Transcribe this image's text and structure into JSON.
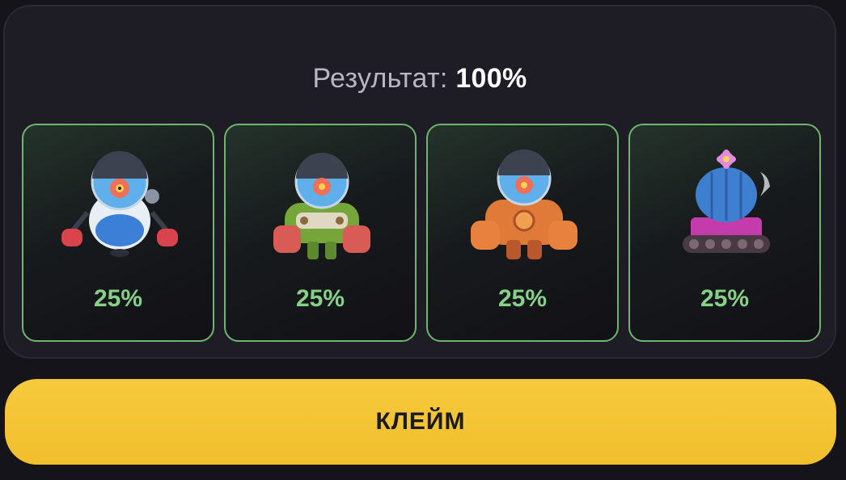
{
  "result": {
    "label": "Результат:",
    "value": "100%"
  },
  "items": [
    {
      "name": "blue-robot",
      "percent": "25%"
    },
    {
      "name": "green-robot",
      "percent": "25%"
    },
    {
      "name": "orange-robot",
      "percent": "25%"
    },
    {
      "name": "cactus-tank",
      "percent": "25%"
    }
  ],
  "claim_button": {
    "label": "КЛЕЙМ"
  },
  "colors": {
    "accent": "#f3c334",
    "success": "#86d187",
    "card_border": "#6fb56f",
    "background": "#15141b"
  }
}
